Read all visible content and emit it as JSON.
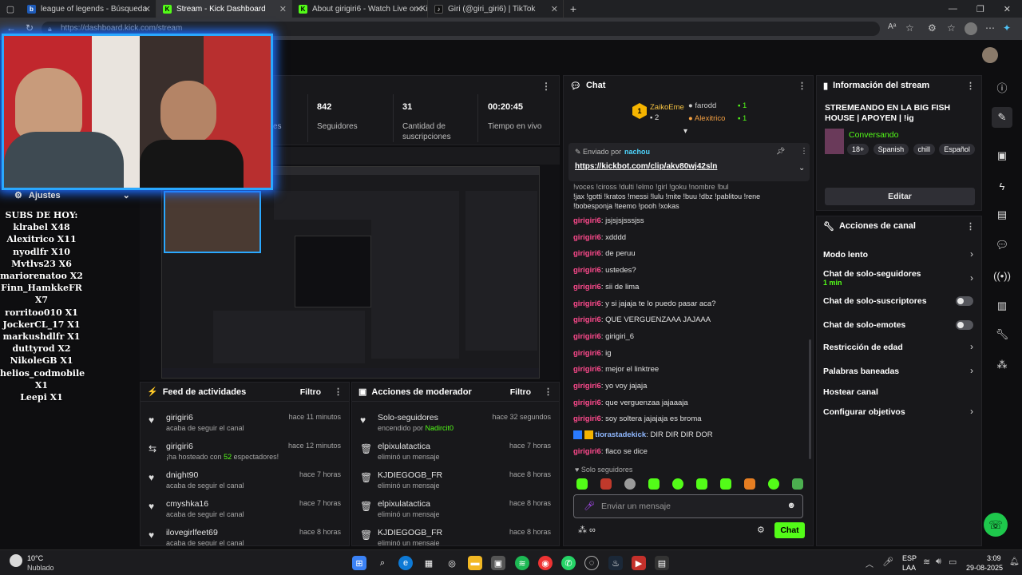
{
  "browser": {
    "tabs": [
      {
        "title": "league of legends - Búsqueda",
        "icon": "bing-icon",
        "color": "#1e5bb8"
      },
      {
        "title": "Stream - Kick Dashboard",
        "icon": "kick-icon",
        "color": "#53fc18"
      },
      {
        "title": "About girigiri6 - Watch Live on Ki",
        "icon": "kick-icon",
        "color": "#53fc18"
      },
      {
        "title": "Giri (@giri_giri6) | TikTok",
        "icon": "tiktok-icon",
        "color": "#111111"
      }
    ],
    "url": "https://dashboard.kick.com/stream"
  },
  "stats": {
    "partial_label": "es",
    "followers": "842",
    "followers_label": "Seguidores",
    "subs": "31",
    "subs_label": "Cantidad de suscripciones",
    "time": "00:20:45",
    "time_label": "Tiempo en vivo"
  },
  "settings_label": "Ajustes",
  "subs_overlay": {
    "title": "SUBS DE HOY:",
    "lines": [
      "klrabel X48",
      "Alexitrico X11",
      "nyodlfr X10",
      "Mvtlvs23 X6",
      "mariorenatoo X2",
      "Finn_HamkkeFR X7",
      "rorritoo010 X1",
      "JockerCL_17 X1",
      "markushdlfr X1",
      "duttyrod X2",
      "NikoleGB X1",
      "helios_codmobile X1",
      "Leepi X1"
    ]
  },
  "activity": {
    "title": "Feed de actividades",
    "filter": "Filtro",
    "items": [
      {
        "name": "girigiri6",
        "sub": "acaba de seguir el canal",
        "time": "hace 11 minutos",
        "icon": "heart-icon"
      },
      {
        "name": "girigiri6",
        "sub_pre": "¡ha hosteado con ",
        "sub_num": "52",
        "sub_post": " espectadores!",
        "time": "hace 12 minutos",
        "icon": "host-icon"
      },
      {
        "name": "dnight90",
        "sub": "acaba de seguir el canal",
        "time": "hace 7 horas",
        "icon": "heart-icon"
      },
      {
        "name": "cmyshka16",
        "sub": "acaba de seguir el canal",
        "time": "hace 7 horas",
        "icon": "heart-icon"
      },
      {
        "name": "ilovegirlfeet69",
        "sub": "acaba de seguir el canal",
        "time": "hace 8 horas",
        "icon": "heart-icon"
      }
    ]
  },
  "mod": {
    "title": "Acciones de moderador",
    "filter": "Filtro",
    "items": [
      {
        "name": "Solo-seguidores",
        "sub_pre": "encendido por ",
        "sub_user": "Nadircit0",
        "time": "hace 32 segundos",
        "icon": "heart-icon"
      },
      {
        "name": "elpixulatactica",
        "sub": "eliminó un mensaje",
        "time": "hace 7 horas",
        "icon": "trash-icon"
      },
      {
        "name": "KJDIEGOGB_FR",
        "sub": "eliminó un mensaje",
        "time": "hace 8 horas",
        "icon": "trash-icon"
      },
      {
        "name": "elpixulatactica",
        "sub": "eliminó un mensaje",
        "time": "hace 8 horas",
        "icon": "trash-icon"
      },
      {
        "name": "KJDIEGOGB_FR",
        "sub": "eliminó un mensaje",
        "time": "hace 8 horas",
        "icon": "trash-icon"
      }
    ]
  },
  "chat": {
    "title": "Chat",
    "leaders": [
      {
        "name": "ZaikoEme",
        "count": "2",
        "rank": "1"
      },
      {
        "name": "farodd",
        "count": "1"
      },
      {
        "name": "Alexitrico",
        "count": "1"
      }
    ],
    "pinned_by_label": "Enviado por",
    "pinned_user": "nachou",
    "pinned_link": "https://kickbot.com/clip/akv80wj42sln",
    "cut_line1": "!voces !ciross !dulti !elmo !girl !goku !nombre !bul",
    "cut_line2": "!jax !gotti !kratos !messi !lulu !mite !buu !dbz !pablitou !rene",
    "cut_line3": "!bobesponja !teemo !pooh !xokas",
    "messages": [
      {
        "user": "girigiri6",
        "text": ": jsjsjsjsssjss"
      },
      {
        "user": "girigiri6",
        "text": ": xdddd"
      },
      {
        "user": "girigiri6",
        "text": ": de peruu"
      },
      {
        "user": "girigiri6",
        "text": ": ustedes?"
      },
      {
        "user": "girigiri6",
        "text": ": sii de lima"
      },
      {
        "user": "girigiri6",
        "text": ": y si jajaja te lo puedo pasar aca?"
      },
      {
        "user": "girigiri6",
        "text": ": QUE VERGUENZAAA JAJAAA"
      },
      {
        "user": "girigiri6",
        "text": ": girigiri_6"
      },
      {
        "user": "girigiri6",
        "text": ": ig"
      },
      {
        "user": "girigiri6",
        "text": ": mejor el linktree"
      },
      {
        "user": "girigiri6",
        "text": ": yo voy jajaja"
      },
      {
        "user": "girigiri6",
        "text": ": que verguenzaa jajaaaja"
      },
      {
        "user": "girigiri6",
        "text": ": soy soltera jajajaja es broma"
      }
    ],
    "special_user": "tiorastadekick",
    "special_text": ": DIR DIR DIR DOR",
    "last_user": "girigiri6",
    "last_text": ": flaco se dice",
    "mode_label": "Solo seguidores",
    "placeholder": "Enviar un mensaje",
    "send": "Chat"
  },
  "info": {
    "title": "Información del stream",
    "stream_title": "STREMEANDO EN LA BIG FISH HOUSE | APOYEN | !ig",
    "category": "Conversando",
    "tags": [
      "18+",
      "Spanish",
      "chill",
      "Español"
    ],
    "edit": "Editar"
  },
  "actions": {
    "title": "Acciones de canal",
    "slow": "Modo lento",
    "followers_only": "Chat de solo-seguidores",
    "followers_time": "1 min",
    "subs_only": "Chat de solo-suscriptores",
    "emotes_only": "Chat de solo-emotes",
    "age": "Restricción de edad",
    "banned": "Palabras baneadas",
    "host": "Hostear canal",
    "goals": "Configurar objetivos"
  },
  "taskbar": {
    "temp": "10°C",
    "weather": "Nublado",
    "lang1": "ESP",
    "lang2": "LAA",
    "time": "3:09",
    "date": "29-08-2025"
  },
  "colors": {
    "accent": "#53fc18",
    "username": "#ff4a8d",
    "webcam_glow": "#2aa8ff"
  }
}
